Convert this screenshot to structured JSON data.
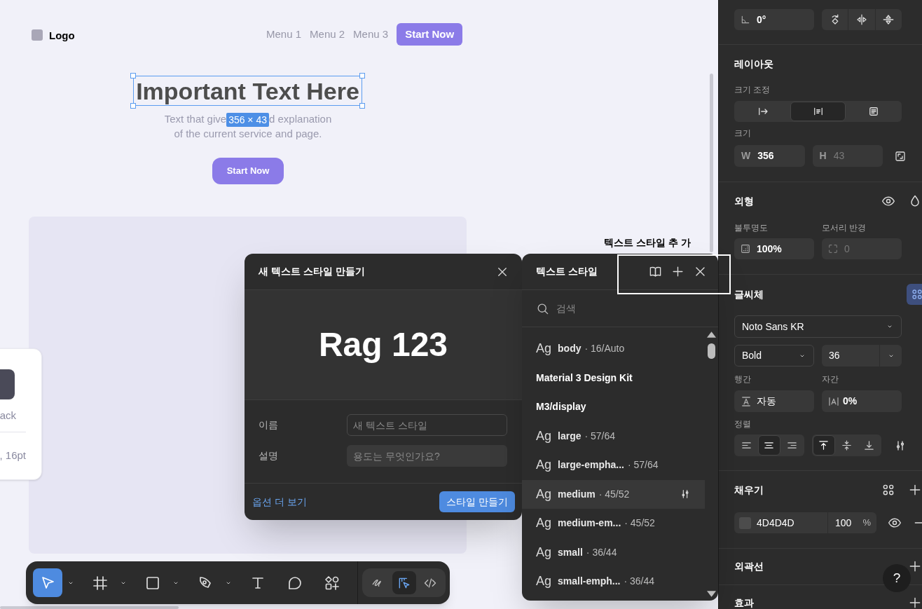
{
  "canvas": {
    "nav": {
      "logo": "Logo",
      "menu": [
        "Menu 1",
        "Menu 2",
        "Menu 3"
      ],
      "cta": "Start Now"
    },
    "hero": {
      "heading": "Important Text Here",
      "selected": true,
      "size_badge": "356 × 43",
      "subtitle_start": "Text that give",
      "subtitle_end": "d explanation",
      "subtitle_line2": "of the current service and page.",
      "button": "Start Now"
    },
    "side_card": {
      "label": "ack",
      "detail": ", 16pt"
    },
    "annotation": "텍스트 스타일 추 가"
  },
  "new_style_dialog": {
    "title": "새 텍스트 스타일 만들기",
    "preview": "Rag 123",
    "fields": [
      {
        "label": "이름",
        "placeholder": "새 텍스트 스타일",
        "kind": "outlined"
      },
      {
        "label": "설명",
        "placeholder": "용도는 무엇인가요?",
        "kind": "filled"
      }
    ],
    "more_link": "옵션 더 보기",
    "create_button": "스타일 만들기"
  },
  "text_styles_panel": {
    "title": "텍스트 스타일",
    "search": {
      "placeholder": "검색"
    },
    "items": [
      {
        "kind": "style",
        "sample": "Ag",
        "name": "body",
        "spec": "· 16/Auto",
        "hovered": false
      },
      {
        "kind": "group",
        "name": "Material 3 Design Kit"
      },
      {
        "kind": "group",
        "name": "M3/display"
      },
      {
        "kind": "style",
        "sample": "Ag",
        "name": "large",
        "spec": "· 57/64",
        "hovered": false
      },
      {
        "kind": "style",
        "sample": "Ag",
        "name": "large-empha...",
        "spec": "· 57/64",
        "hovered": false
      },
      {
        "kind": "style",
        "sample": "Ag",
        "name": "medium",
        "spec": "· 45/52",
        "hovered": true
      },
      {
        "kind": "style",
        "sample": "Ag",
        "name": "medium-em...",
        "spec": "· 45/52",
        "hovered": false
      },
      {
        "kind": "style",
        "sample": "Ag",
        "name": "small",
        "spec": "· 36/44",
        "hovered": false
      },
      {
        "kind": "style",
        "sample": "Ag",
        "name": "small-emph...",
        "spec": "· 36/44",
        "hovered": false
      }
    ]
  },
  "toolbar": {
    "tools": [
      {
        "kind": "move",
        "selected": true,
        "dropdown": true
      },
      {
        "kind": "frame",
        "selected": false,
        "dropdown": true
      },
      {
        "kind": "rectangle",
        "selected": false,
        "dropdown": true
      },
      {
        "kind": "pen",
        "selected": false,
        "dropdown": true
      },
      {
        "kind": "text",
        "selected": false,
        "dropdown": false
      },
      {
        "kind": "comment",
        "selected": false,
        "dropdown": false
      },
      {
        "kind": "components",
        "selected": false,
        "dropdown": false
      }
    ],
    "modes": [
      {
        "kind": "draw",
        "selected": false
      },
      {
        "kind": "design",
        "selected": true
      },
      {
        "kind": "dev",
        "selected": false
      }
    ]
  },
  "inspector": {
    "rotation": {
      "value": "0°"
    },
    "layout": {
      "title": "레이아웃",
      "resize_label": "크기 조정",
      "resize_modes": [
        {
          "kind": "hug",
          "selected": false
        },
        {
          "kind": "fixed",
          "selected": true
        },
        {
          "kind": "fill",
          "selected": false
        }
      ],
      "size_label": "크기",
      "width": {
        "label": "W",
        "value": "356",
        "disabled": false
      },
      "height": {
        "label": "H",
        "value": "43",
        "disabled": true
      }
    },
    "appearance": {
      "title": "외형",
      "opacity_label": "불투명도",
      "opacity": "100%",
      "radius_label": "모서리 반경",
      "radius": "0",
      "radius_disabled": true
    },
    "typography": {
      "title": "글씨체",
      "font": "Noto Sans KR",
      "weight": "Bold",
      "size": "36",
      "line_height_label": "행간",
      "line_height": "자동",
      "letter_spacing_label": "자간",
      "letter_spacing": "0%",
      "align_label": "정렬",
      "h_align": [
        {
          "kind": "left",
          "selected": false
        },
        {
          "kind": "center",
          "selected": true
        },
        {
          "kind": "right",
          "selected": false
        }
      ],
      "v_align": [
        {
          "kind": "top",
          "selected": true
        },
        {
          "kind": "middle",
          "selected": false
        },
        {
          "kind": "bottom",
          "selected": false
        }
      ]
    },
    "fill": {
      "title": "채우기",
      "color": "#4d4d4d",
      "hex": "4D4D4D",
      "opacity": "100",
      "unit": "%",
      "visible": true
    },
    "stroke": {
      "title": "외곽선"
    },
    "effects": {
      "title": "효과"
    },
    "help": "?"
  }
}
